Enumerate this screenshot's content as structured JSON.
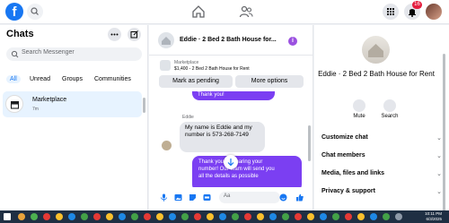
{
  "topbar": {
    "logo": "f",
    "notification_count": "16"
  },
  "left": {
    "title": "Chats",
    "search_placeholder": "Search Messenger",
    "tabs": [
      {
        "label": "All"
      },
      {
        "label": "Unread"
      },
      {
        "label": "Groups"
      },
      {
        "label": "Communities"
      }
    ],
    "chat": {
      "name": "Marketplace",
      "time": "7m"
    }
  },
  "convo": {
    "name": "Eddie · 2 Bed 2 Bath House for...",
    "info_icon": "i",
    "listing_source": "Marketplace",
    "listing_title": "$1,400 - 2 Bed 2 Bath House for Rent",
    "mark_pending": "Mark as pending",
    "more_options": "More options",
    "msg_thanks": "Thank you!",
    "sender": "Eddie",
    "msg_in": "My name is Eddie and my number is 573-268-7149",
    "msg_out_line1": "Thank you for sharing your",
    "msg_out_line2": "number! Our team will send you",
    "msg_out_line3": "all the details as possible",
    "composer_placeholder": "Aa"
  },
  "right": {
    "name": "Eddie · 2 Bed 2 Bath House for Rent",
    "mute": "Mute",
    "search": "Search",
    "sections": [
      {
        "label": "Customize chat"
      },
      {
        "label": "Chat members"
      },
      {
        "label": "Media, files and links"
      },
      {
        "label": "Privacy & support"
      }
    ]
  },
  "taskbar": {
    "time": "10:11 PM",
    "date": "6/3/2025"
  },
  "colors": {
    "accent": "#1877f2",
    "outgoing_bubble": "#7b3ff2",
    "badge": "#e41e3f"
  }
}
